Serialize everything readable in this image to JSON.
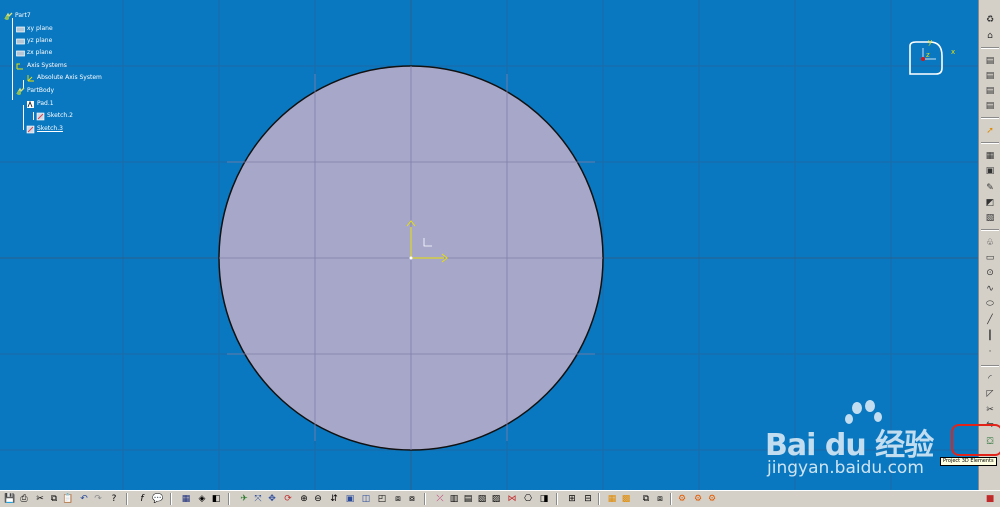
{
  "tree": {
    "items": [
      {
        "label": "Part7",
        "icon": "part-icon"
      },
      {
        "label": "xy plane",
        "icon": "plane-icon"
      },
      {
        "label": "yz plane",
        "icon": "plane-icon"
      },
      {
        "label": "zx plane",
        "icon": "plane-icon"
      },
      {
        "label": "Axis Systems",
        "icon": "folder-icon"
      },
      {
        "label": "Absolute Axis System",
        "icon": "axis-system-icon"
      },
      {
        "label": "PartBody",
        "icon": "partbody-icon"
      },
      {
        "label": "Pad.1",
        "icon": "pad-icon"
      },
      {
        "label": "Sketch.2",
        "icon": "sketch-icon"
      },
      {
        "label": "Sketch.3",
        "icon": "sketch-icon"
      }
    ]
  },
  "compass": {
    "x_label": "x",
    "y_label": "y",
    "z_label": "z"
  },
  "tooltip": {
    "text": "Project 3D Elements"
  },
  "watermark": {
    "brand": "Bai du 经验",
    "url": "jingyan.baidu.com"
  },
  "colors": {
    "viewport_bg": "#0a78c0",
    "circle_fill": "#a7a7ca",
    "toolbar_bg": "#d4d0c8",
    "highlight": "#e2231a",
    "axis_yellow": "#e8e000"
  },
  "right_toolbar": {
    "icons": [
      "exit-workbench-icon",
      "sketch-icon",
      "select-icon",
      "grid-icon",
      "snap-icon",
      "construction-icon",
      "geometric-constraint-icon",
      "profile-icon",
      "rectangle-icon",
      "circle-icon",
      "spline-icon",
      "ellipse-icon",
      "line-icon",
      "axis-icon",
      "point-icon",
      "corner-icon",
      "chamfer-icon",
      "trim-icon",
      "mirror-icon",
      "project-3d-elements-icon"
    ]
  },
  "bottom_toolbar": {
    "icons": [
      "save-icon",
      "print-icon",
      "cut-icon",
      "copy-icon",
      "paste-icon",
      "undo-icon",
      "redo-icon",
      "whats-this-icon",
      "formula-icon",
      "comment-icon",
      "catalog-icon",
      "cube-icon",
      "fly-mode-icon",
      "fit-all-icon",
      "pan-icon",
      "rotate-icon",
      "zoom-in-icon",
      "zoom-out-icon",
      "normal-view-icon",
      "iso-view-icon",
      "hide-show-icon",
      "swap-icon",
      "sketch-analysis-icon",
      "constraint-icon",
      "dimension-icon",
      "auto-constraint-icon",
      "animate-icon",
      "edit-icon",
      "cut-part-icon",
      "visualization-icon",
      "grid-toggle-icon",
      "snap-toggle-icon",
      "construction-toggle-icon",
      "measure-icon",
      "bookmark-icon",
      "help-icon"
    ]
  }
}
